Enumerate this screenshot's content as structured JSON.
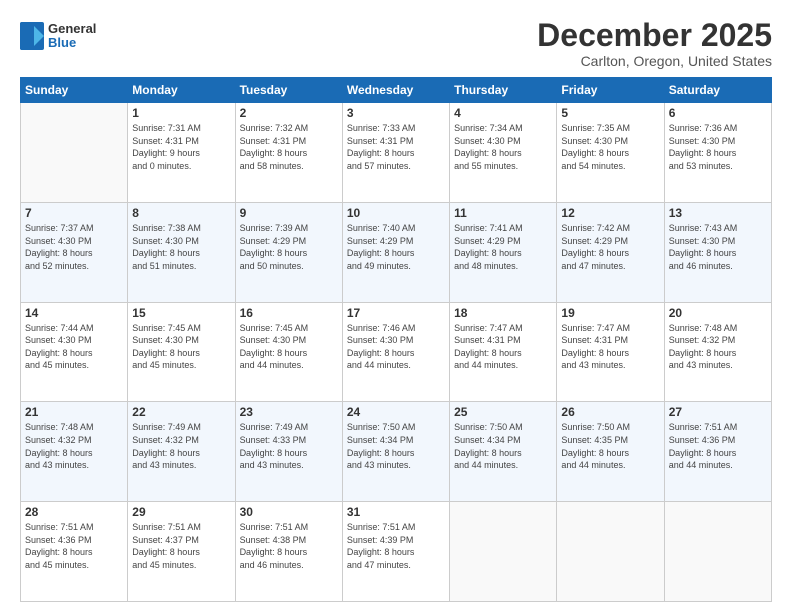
{
  "header": {
    "logo": {
      "general": "General",
      "blue": "Blue"
    },
    "title": "December 2025",
    "location": "Carlton, Oregon, United States"
  },
  "weekdays": [
    "Sunday",
    "Monday",
    "Tuesday",
    "Wednesday",
    "Thursday",
    "Friday",
    "Saturday"
  ],
  "weeks": [
    [
      {
        "day": "",
        "content": ""
      },
      {
        "day": "1",
        "content": "Sunrise: 7:31 AM\nSunset: 4:31 PM\nDaylight: 9 hours\nand 0 minutes."
      },
      {
        "day": "2",
        "content": "Sunrise: 7:32 AM\nSunset: 4:31 PM\nDaylight: 8 hours\nand 58 minutes."
      },
      {
        "day": "3",
        "content": "Sunrise: 7:33 AM\nSunset: 4:31 PM\nDaylight: 8 hours\nand 57 minutes."
      },
      {
        "day": "4",
        "content": "Sunrise: 7:34 AM\nSunset: 4:30 PM\nDaylight: 8 hours\nand 55 minutes."
      },
      {
        "day": "5",
        "content": "Sunrise: 7:35 AM\nSunset: 4:30 PM\nDaylight: 8 hours\nand 54 minutes."
      },
      {
        "day": "6",
        "content": "Sunrise: 7:36 AM\nSunset: 4:30 PM\nDaylight: 8 hours\nand 53 minutes."
      }
    ],
    [
      {
        "day": "7",
        "content": "Sunrise: 7:37 AM\nSunset: 4:30 PM\nDaylight: 8 hours\nand 52 minutes."
      },
      {
        "day": "8",
        "content": "Sunrise: 7:38 AM\nSunset: 4:30 PM\nDaylight: 8 hours\nand 51 minutes."
      },
      {
        "day": "9",
        "content": "Sunrise: 7:39 AM\nSunset: 4:29 PM\nDaylight: 8 hours\nand 50 minutes."
      },
      {
        "day": "10",
        "content": "Sunrise: 7:40 AM\nSunset: 4:29 PM\nDaylight: 8 hours\nand 49 minutes."
      },
      {
        "day": "11",
        "content": "Sunrise: 7:41 AM\nSunset: 4:29 PM\nDaylight: 8 hours\nand 48 minutes."
      },
      {
        "day": "12",
        "content": "Sunrise: 7:42 AM\nSunset: 4:29 PM\nDaylight: 8 hours\nand 47 minutes."
      },
      {
        "day": "13",
        "content": "Sunrise: 7:43 AM\nSunset: 4:30 PM\nDaylight: 8 hours\nand 46 minutes."
      }
    ],
    [
      {
        "day": "14",
        "content": "Sunrise: 7:44 AM\nSunset: 4:30 PM\nDaylight: 8 hours\nand 45 minutes."
      },
      {
        "day": "15",
        "content": "Sunrise: 7:45 AM\nSunset: 4:30 PM\nDaylight: 8 hours\nand 45 minutes."
      },
      {
        "day": "16",
        "content": "Sunrise: 7:45 AM\nSunset: 4:30 PM\nDaylight: 8 hours\nand 44 minutes."
      },
      {
        "day": "17",
        "content": "Sunrise: 7:46 AM\nSunset: 4:30 PM\nDaylight: 8 hours\nand 44 minutes."
      },
      {
        "day": "18",
        "content": "Sunrise: 7:47 AM\nSunset: 4:31 PM\nDaylight: 8 hours\nand 44 minutes."
      },
      {
        "day": "19",
        "content": "Sunrise: 7:47 AM\nSunset: 4:31 PM\nDaylight: 8 hours\nand 43 minutes."
      },
      {
        "day": "20",
        "content": "Sunrise: 7:48 AM\nSunset: 4:32 PM\nDaylight: 8 hours\nand 43 minutes."
      }
    ],
    [
      {
        "day": "21",
        "content": "Sunrise: 7:48 AM\nSunset: 4:32 PM\nDaylight: 8 hours\nand 43 minutes."
      },
      {
        "day": "22",
        "content": "Sunrise: 7:49 AM\nSunset: 4:32 PM\nDaylight: 8 hours\nand 43 minutes."
      },
      {
        "day": "23",
        "content": "Sunrise: 7:49 AM\nSunset: 4:33 PM\nDaylight: 8 hours\nand 43 minutes."
      },
      {
        "day": "24",
        "content": "Sunrise: 7:50 AM\nSunset: 4:34 PM\nDaylight: 8 hours\nand 43 minutes."
      },
      {
        "day": "25",
        "content": "Sunrise: 7:50 AM\nSunset: 4:34 PM\nDaylight: 8 hours\nand 44 minutes."
      },
      {
        "day": "26",
        "content": "Sunrise: 7:50 AM\nSunset: 4:35 PM\nDaylight: 8 hours\nand 44 minutes."
      },
      {
        "day": "27",
        "content": "Sunrise: 7:51 AM\nSunset: 4:36 PM\nDaylight: 8 hours\nand 44 minutes."
      }
    ],
    [
      {
        "day": "28",
        "content": "Sunrise: 7:51 AM\nSunset: 4:36 PM\nDaylight: 8 hours\nand 45 minutes."
      },
      {
        "day": "29",
        "content": "Sunrise: 7:51 AM\nSunset: 4:37 PM\nDaylight: 8 hours\nand 45 minutes."
      },
      {
        "day": "30",
        "content": "Sunrise: 7:51 AM\nSunset: 4:38 PM\nDaylight: 8 hours\nand 46 minutes."
      },
      {
        "day": "31",
        "content": "Sunrise: 7:51 AM\nSunset: 4:39 PM\nDaylight: 8 hours\nand 47 minutes."
      },
      {
        "day": "",
        "content": ""
      },
      {
        "day": "",
        "content": ""
      },
      {
        "day": "",
        "content": ""
      }
    ]
  ]
}
